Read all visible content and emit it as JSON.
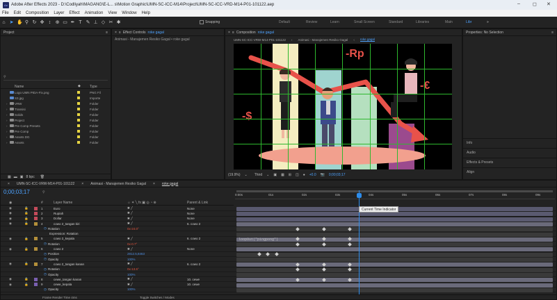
{
  "app": {
    "title": "Adobe After Effects 2023 - D:\\Codliyah\\MAGANG\\E-L... s\\Motion Graphic\\UMN-SC-ICC-M14\\Project\\UMN-SC-ICC-VRD-M14-P01-101122.aep",
    "win_min": "–",
    "win_max": "◻",
    "win_close": "✕"
  },
  "menu": [
    "File",
    "Edit",
    "Composition",
    "Layer",
    "Effect",
    "Animation",
    "View",
    "Window",
    "Help"
  ],
  "toolbar": {
    "snapping": "Snapping",
    "workspaces": [
      "Default",
      "Review",
      "Learn",
      "Small Screen",
      "Standard",
      "Libraries",
      "Main"
    ],
    "active_workspace": "Libr",
    "more": "»"
  },
  "project": {
    "title": "Project",
    "search_placeholder": "",
    "col_name": "Name",
    "col_type": "Type",
    "items": [
      {
        "name": "Logo UMN PIDA-Fix.png",
        "type": "PNG Fil",
        "kind": "file"
      },
      {
        "name": "S3.jpg",
        "type": "Importe",
        "kind": "file"
      },
      {
        "name": "VRW",
        "type": "Folder",
        "kind": "folder"
      },
      {
        "name": "Transisi",
        "type": "Folder",
        "kind": "folder"
      },
      {
        "name": "Solids",
        "type": "Folder",
        "kind": "folder"
      },
      {
        "name": "Project",
        "type": "Folder",
        "kind": "folder"
      },
      {
        "name": "Pre Comp Presets",
        "type": "Folder",
        "kind": "folder"
      },
      {
        "name": "Pre Comp",
        "type": "Folder",
        "kind": "folder"
      },
      {
        "name": "Assets DG",
        "type": "Folder",
        "kind": "folder"
      },
      {
        "name": "Assets",
        "type": "Folder",
        "kind": "folder"
      }
    ],
    "footer_bpc": "8 bpc"
  },
  "effect_controls": {
    "title": "Effect Controls",
    "layer": "roke gagal",
    "breadcrumb": "Animasi - Manajemen Resiko Gagal • roke gagal"
  },
  "composition": {
    "title": "Composition",
    "comp_name": "roke gagal",
    "crumbs": [
      "UMN-SC-ICC-VRW-M14-P01-101122",
      "Animasi - Manajemen Resiko Gagal",
      "roke gagal"
    ],
    "zoom": "(19.9%)",
    "quality": "Third",
    "exposure": "+0.0",
    "timecode": "0;00;03;17"
  },
  "artwork": {
    "label_rp": "-Rp",
    "label_dollar": "-$",
    "label_euro": "-€"
  },
  "properties": {
    "title": "Properties: No Selection",
    "side_items": [
      "Info",
      "Audio",
      "Effects & Presets",
      "Align"
    ]
  },
  "timeline": {
    "tabs": [
      "UMN-SC-ICC-VRW-M14-P01-101122",
      "Animasi - Manajemen Resiko Gagal",
      "roke gagal"
    ],
    "active_tab": "roke gagal",
    "timecode": "0;00;03;17",
    "col_layer_name": "Layer Name",
    "col_parent": "Parent & Link",
    "ruler": [
      "0:00s",
      "01s",
      "02s",
      "03s",
      "04s",
      "05s",
      "06s",
      "07s",
      "08s",
      "09s"
    ],
    "tooltip": "Current Time Indicator",
    "expression_text": "loopOut(\"pingpong\")",
    "footer_left": "Frame Render Time  4ms",
    "footer_mid": "Toggle Switches / Modes",
    "rows": [
      {
        "num": "1",
        "name": "Euro",
        "parent": "None",
        "kind": "layer",
        "color": "#c44a5a"
      },
      {
        "num": "2",
        "name": "Rupiah",
        "parent": "None",
        "kind": "layer",
        "color": "#c44a5a"
      },
      {
        "num": "3",
        "name": "Dollar",
        "parent": "None",
        "kind": "layer",
        "color": "#c44a5a"
      },
      {
        "num": "4",
        "name": "cowo 2_tangan kiri",
        "parent": "6. cowo 2",
        "kind": "layer",
        "color": "#b38f3a"
      },
      {
        "num": "",
        "name": "Rotation",
        "val": "0x-24.0°",
        "kind": "prop"
      },
      {
        "num": "",
        "name": "Expression: Rotation",
        "kind": "expr"
      },
      {
        "num": "5",
        "name": "cowo 2_kepala",
        "parent": "6. cowo 2",
        "kind": "layer",
        "color": "#b38f3a"
      },
      {
        "num": "",
        "name": "Rotation",
        "val": "0x-0.7°",
        "kind": "prop"
      },
      {
        "num": "6",
        "name": "cowo 2",
        "parent": "None",
        "kind": "layer",
        "color": "#b38f3a"
      },
      {
        "num": "",
        "name": "Position",
        "valb": "2812.5,8463",
        "kind": "prop"
      },
      {
        "num": "",
        "name": "Opacity",
        "valb": "100%",
        "kind": "prop"
      },
      {
        "num": "7",
        "name": "cowo 2_tangan kanan",
        "parent": "6. cowo 2",
        "kind": "layer",
        "color": "#b38f3a"
      },
      {
        "num": "",
        "name": "Rotation",
        "val": "0x-13.6°",
        "kind": "prop"
      },
      {
        "num": "",
        "name": "Opacity",
        "valb": "100%",
        "kind": "prop"
      },
      {
        "num": "8",
        "name": "cewe_tangan kanan",
        "parent": "10. cewe",
        "kind": "layer",
        "color": "#7a5fb0"
      },
      {
        "num": "9",
        "name": "cewe_kepala",
        "parent": "10. cewe",
        "kind": "layer",
        "color": "#7a5fb0"
      },
      {
        "num": "",
        "name": "Opacity",
        "valb": "100%",
        "kind": "prop"
      }
    ]
  },
  "colors": {
    "accent": "#2d8ceb",
    "grid": "#2eb82e",
    "playhead": "#2d8ceb"
  }
}
